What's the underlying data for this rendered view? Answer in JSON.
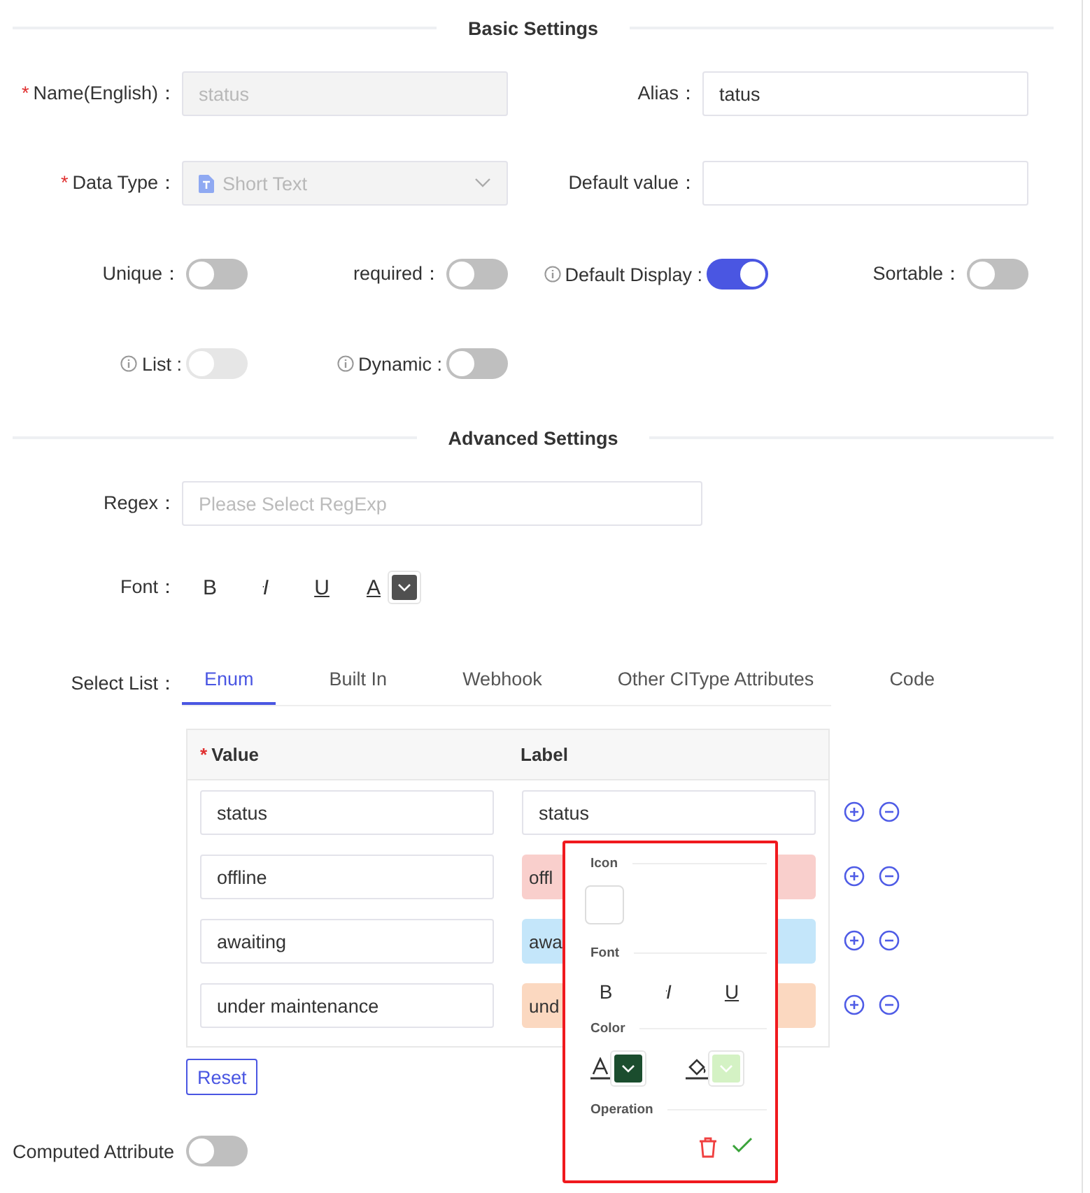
{
  "basic_settings": {
    "title": "Basic Settings",
    "fields": [
      {
        "label": "Name(English)：",
        "required_mark": "*",
        "kind": "input",
        "value": "status",
        "disabled": true
      },
      {
        "label": "Alias：",
        "kind": "input",
        "value": "tatus",
        "disabled": false
      },
      {
        "label": "Data Type：",
        "required_mark": "*",
        "kind": "select",
        "value": "Short Text",
        "disabled": true
      },
      {
        "label": "Default value：",
        "kind": "input",
        "disabled": false
      }
    ],
    "toggles": [
      {
        "label": "Unique：",
        "info": false,
        "on": false,
        "disabled": false
      },
      {
        "label": "required：",
        "info": false,
        "on": false,
        "disabled": false
      },
      {
        "label": "Default Display :",
        "info": true,
        "on": true,
        "disabled": false
      },
      {
        "label": "Sortable：",
        "info": false,
        "on": false,
        "disabled": false
      },
      {
        "label": "List :",
        "info": true,
        "on": false,
        "disabled": true
      },
      {
        "label": "Dynamic :",
        "info": true,
        "on": false,
        "disabled": false
      }
    ]
  },
  "advanced_settings": {
    "title": "Advanced Settings",
    "regex": {
      "label": "Regex：",
      "placeholder": "Please Select RegExp"
    },
    "font": {
      "label": "Font：",
      "buttons": [
        "B",
        "I",
        "U",
        "A"
      ],
      "color": "#505050"
    },
    "select_list": {
      "label": "Select List：",
      "tabs": [
        {
          "label": "Enum",
          "selected": true
        },
        {
          "label": "Built In",
          "selected": false
        },
        {
          "label": "Webhook",
          "selected": false
        },
        {
          "label": "Other CIType Attributes",
          "selected": false
        },
        {
          "label": "Code",
          "selected": false
        }
      ]
    },
    "table": {
      "columns": [
        {
          "label": "Value",
          "required_mark": "*"
        },
        {
          "label": "Label"
        }
      ],
      "rows": [
        {
          "value": "status",
          "label": "status"
        },
        {
          "value": "offline",
          "label": "offl",
          "color": "#f9cfcc"
        },
        {
          "value": "awaiting",
          "label": "awa",
          "color": "#c4e6fa"
        },
        {
          "value": "under maintenance",
          "label": "und",
          "color": "#fbd8c0"
        }
      ]
    },
    "reset_button": "Reset"
  },
  "computed_attribute": {
    "label": "Computed Attribute",
    "on": false
  },
  "style_popover": {
    "sections": [
      "Icon",
      "Font",
      "Color",
      "Operation"
    ],
    "font_buttons": [
      "B",
      "I",
      "U"
    ],
    "text_swatch": {
      "color": "#1b4d2e"
    },
    "fill_swatch": {
      "color": "#d4f2c4"
    }
  }
}
